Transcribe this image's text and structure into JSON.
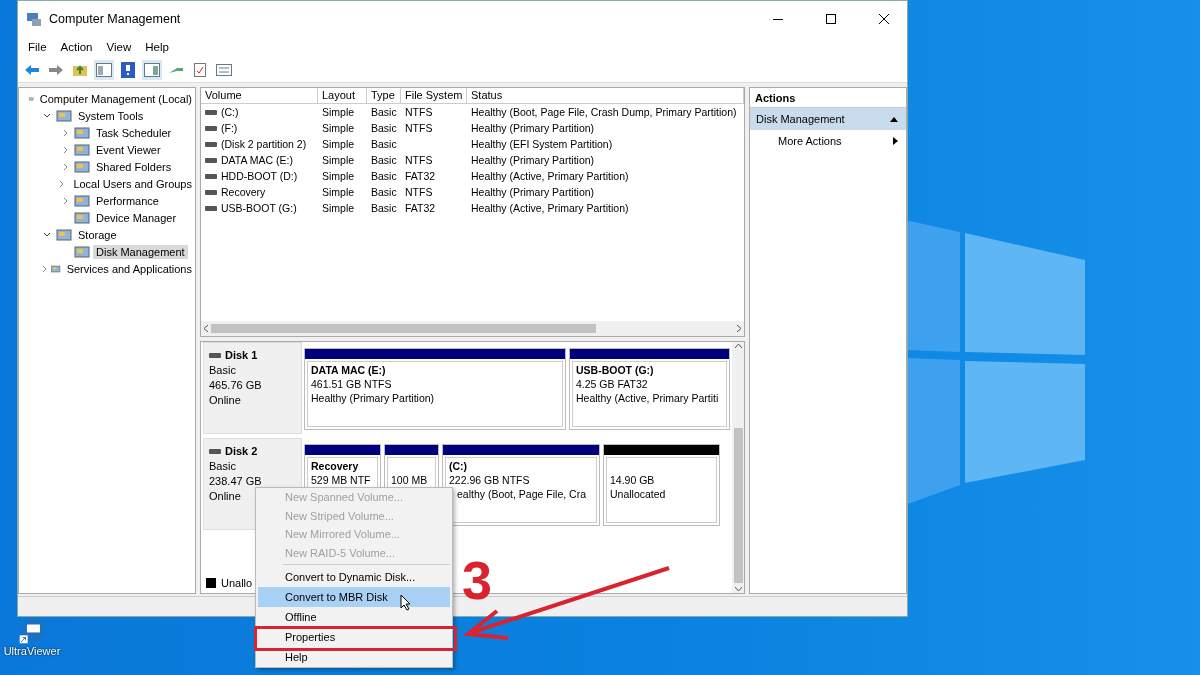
{
  "desktop": {
    "shortcuts": [
      {
        "label": "UltraViewer"
      }
    ]
  },
  "window": {
    "title": "Computer Management"
  },
  "menu_bar": [
    "File",
    "Action",
    "View",
    "Help"
  ],
  "tree": [
    {
      "label": "Computer Management (Local)",
      "selected": false,
      "children": [
        {
          "label": "System Tools",
          "expanded": true,
          "selected": false,
          "children": [
            {
              "label": "Task Scheduler",
              "expanded": false,
              "selected": false
            },
            {
              "label": "Event Viewer",
              "expanded": false,
              "selected": false
            },
            {
              "label": "Shared Folders",
              "expanded": false,
              "selected": false
            },
            {
              "label": "Local Users and Groups",
              "expanded": false,
              "selected": false
            },
            {
              "label": "Performance",
              "expanded": false,
              "selected": false
            },
            {
              "label": "Device Manager",
              "selected": false
            }
          ]
        },
        {
          "label": "Storage",
          "expanded": true,
          "selected": false,
          "children": [
            {
              "label": "Disk Management",
              "selected": true
            }
          ]
        },
        {
          "label": "Services and Applications",
          "expanded": false,
          "selected": false
        }
      ]
    }
  ],
  "volumes": {
    "columns": [
      "Volume",
      "Layout",
      "Type",
      "File System",
      "Status"
    ],
    "rows": [
      [
        "(C:)",
        "Simple",
        "Basic",
        "NTFS",
        "Healthy (Boot, Page File, Crash Dump, Primary Partition)"
      ],
      [
        "(F:)",
        "Simple",
        "Basic",
        "NTFS",
        "Healthy (Primary Partition)"
      ],
      [
        "(Disk 2 partition 2)",
        "Simple",
        "Basic",
        "",
        "Healthy (EFI System Partition)"
      ],
      [
        "DATA MAC (E:)",
        "Simple",
        "Basic",
        "NTFS",
        "Healthy (Primary Partition)"
      ],
      [
        "HDD-BOOT (D:)",
        "Simple",
        "Basic",
        "FAT32",
        "Healthy (Active, Primary Partition)"
      ],
      [
        "Recovery",
        "Simple",
        "Basic",
        "NTFS",
        "Healthy (Primary Partition)"
      ],
      [
        "USB-BOOT (G:)",
        "Simple",
        "Basic",
        "FAT32",
        "Healthy (Active, Primary Partition)"
      ]
    ]
  },
  "disks": [
    {
      "name": "Disk 1",
      "type": "Basic",
      "size": "465.76 GB",
      "status": "Online",
      "partitions": [
        {
          "kind": "primary",
          "name": "DATA MAC  (E:)",
          "detail": "461.51 GB NTFS",
          "status": "Healthy (Primary Partition)"
        },
        {
          "kind": "primary",
          "name": "USB-BOOT  (G:)",
          "detail": "4.25 GB FAT32",
          "status": "Healthy (Active, Primary Partiti"
        }
      ]
    },
    {
      "name": "Disk 2",
      "type": "Basic",
      "size": "238.47 GB",
      "status": "Online",
      "partitions": [
        {
          "kind": "primary",
          "name": "Recovery",
          "detail": "529 MB NTF"
        },
        {
          "kind": "primary",
          "detail": "100 MB"
        },
        {
          "kind": "primary",
          "name": "(C:)",
          "detail": "222.96 GB NTFS",
          "status": "ealthy (Boot, Page File, Cra"
        },
        {
          "kind": "unallocated",
          "detail": "14.90 GB",
          "status": "Unallocated"
        }
      ]
    }
  ],
  "legend": [
    {
      "label": "Unallo",
      "color": "#000000"
    }
  ],
  "actions": {
    "title": "Actions",
    "section": "Disk Management",
    "items": [
      "More Actions"
    ]
  },
  "context_menu": [
    {
      "label": "New Spanned Volume...",
      "disabled": true,
      "selected": false
    },
    {
      "label": "New Striped Volume...",
      "disabled": true,
      "selected": false
    },
    {
      "label": "New Mirrored Volume...",
      "disabled": true,
      "selected": false
    },
    {
      "label": "New RAID-5 Volume...",
      "disabled": true,
      "selected": false
    },
    {
      "label": "Convert to Dynamic Disk...",
      "disabled": false,
      "selected": false
    },
    {
      "label": "Convert to MBR Disk",
      "disabled": false,
      "selected": true
    },
    {
      "label": "Offline",
      "disabled": false,
      "selected": false
    },
    {
      "label": "Properties",
      "disabled": false,
      "selected": false
    },
    {
      "label": "Help",
      "disabled": false,
      "selected": false
    }
  ],
  "annotation": {
    "step": "3"
  }
}
